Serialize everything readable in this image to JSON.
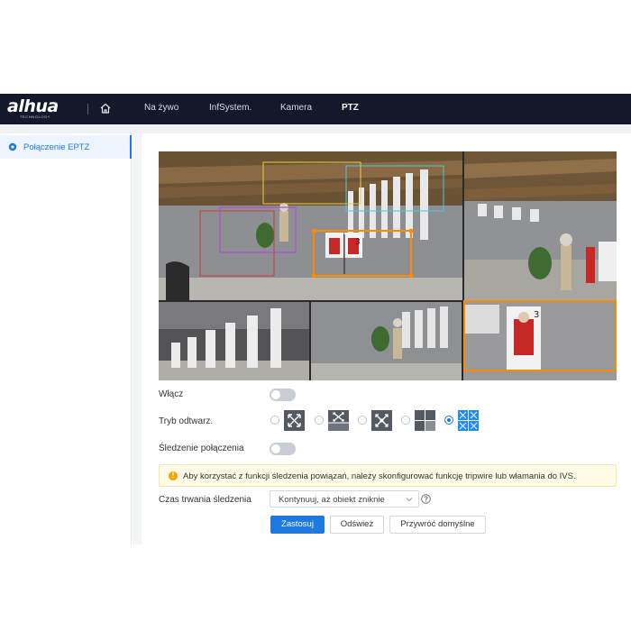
{
  "header": {
    "logo_text": "alhua",
    "logo_subtext": "TECHNOLOGY",
    "nav": [
      "Na żywo",
      "InfSystem.",
      "Kamera",
      "PTZ"
    ],
    "active_nav": "PTZ",
    "home_icon": "home-icon"
  },
  "sidebar": {
    "items": [
      {
        "label": "Połączenie EPTZ",
        "icon": "gear-icon",
        "active": true
      }
    ]
  },
  "form": {
    "enable_label": "Włącz",
    "enable_on": false,
    "mode_label": "Tryb odtwarz.",
    "mode_options": [
      "fisheye-1p-icon",
      "fisheye-1p3-icon",
      "fisheye-1p4-icon",
      "fisheye-1p1-icon",
      "fisheye-1p5-icon"
    ],
    "mode_selected": 4,
    "tracking_label": "Śledzenie połączenia",
    "tracking_on": false,
    "notice_text": "Aby korzystać z funkcji śledzenia powiązań, należy skonfigurować funkcję tripwire lub włamania do IVS.",
    "duration_label": "Czas trwania śledzenia",
    "duration_value": "Kontynuuj, aż obiekt zniknie",
    "buttons": {
      "apply": "Zastosuj",
      "refresh": "Odśwież",
      "default": "Przywróć domyślne"
    }
  },
  "video": {
    "target_numbers": [
      "3",
      "3",
      "3"
    ],
    "box_colors": {
      "orange": "#ff8a00",
      "purple": "#b04ad8",
      "cyan": "#4ac8d8",
      "yellow": "#e8d040",
      "red": "#c83838"
    }
  },
  "colors": {
    "accent": "#1f7ae0",
    "topbar": "#13182a",
    "notice_bg": "#fffbe6",
    "notice_icon": "#f0a500"
  }
}
